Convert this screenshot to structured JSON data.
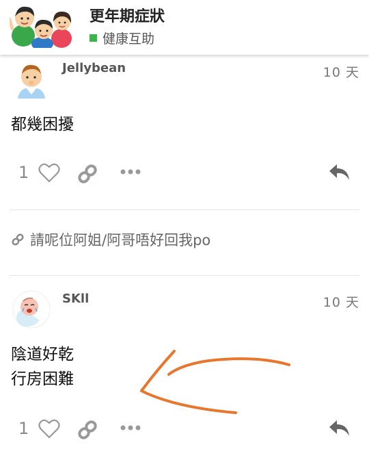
{
  "header": {
    "title": "更年期症狀",
    "category": "健康互助",
    "category_color": "#3ab54a"
  },
  "posts": [
    {
      "username": "Jellybean",
      "date": "10 天",
      "lines": [
        "都幾困擾"
      ],
      "likes": "1"
    },
    {
      "username": "SKll",
      "date": "10 天",
      "lines": [
        "陰道好乾",
        "行房困難"
      ],
      "likes": "1"
    }
  ],
  "link_notice": "請呢位阿姐/阿哥唔好回我po",
  "annotation_color": "#e8762d"
}
